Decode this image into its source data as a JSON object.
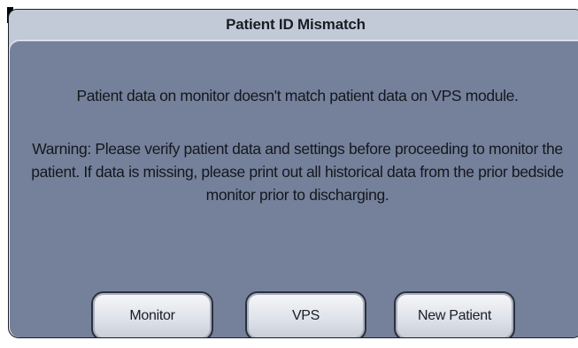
{
  "dialog": {
    "title": "Patient ID Mismatch",
    "message": "Patient data on monitor doesn't match patient data on VPS module.",
    "warning": "Warning: Please verify patient data and settings before proceeding to monitor the patient.  If data is missing, please print out all historical data from the prior bedside monitor prior to discharging.",
    "buttons": {
      "monitor": "Monitor",
      "vps": "VPS",
      "new_patient": "New Patient"
    }
  },
  "colors": {
    "title_bar": "#c3cad7",
    "panel": "#75819b",
    "button_face": "#e4e7ed"
  }
}
